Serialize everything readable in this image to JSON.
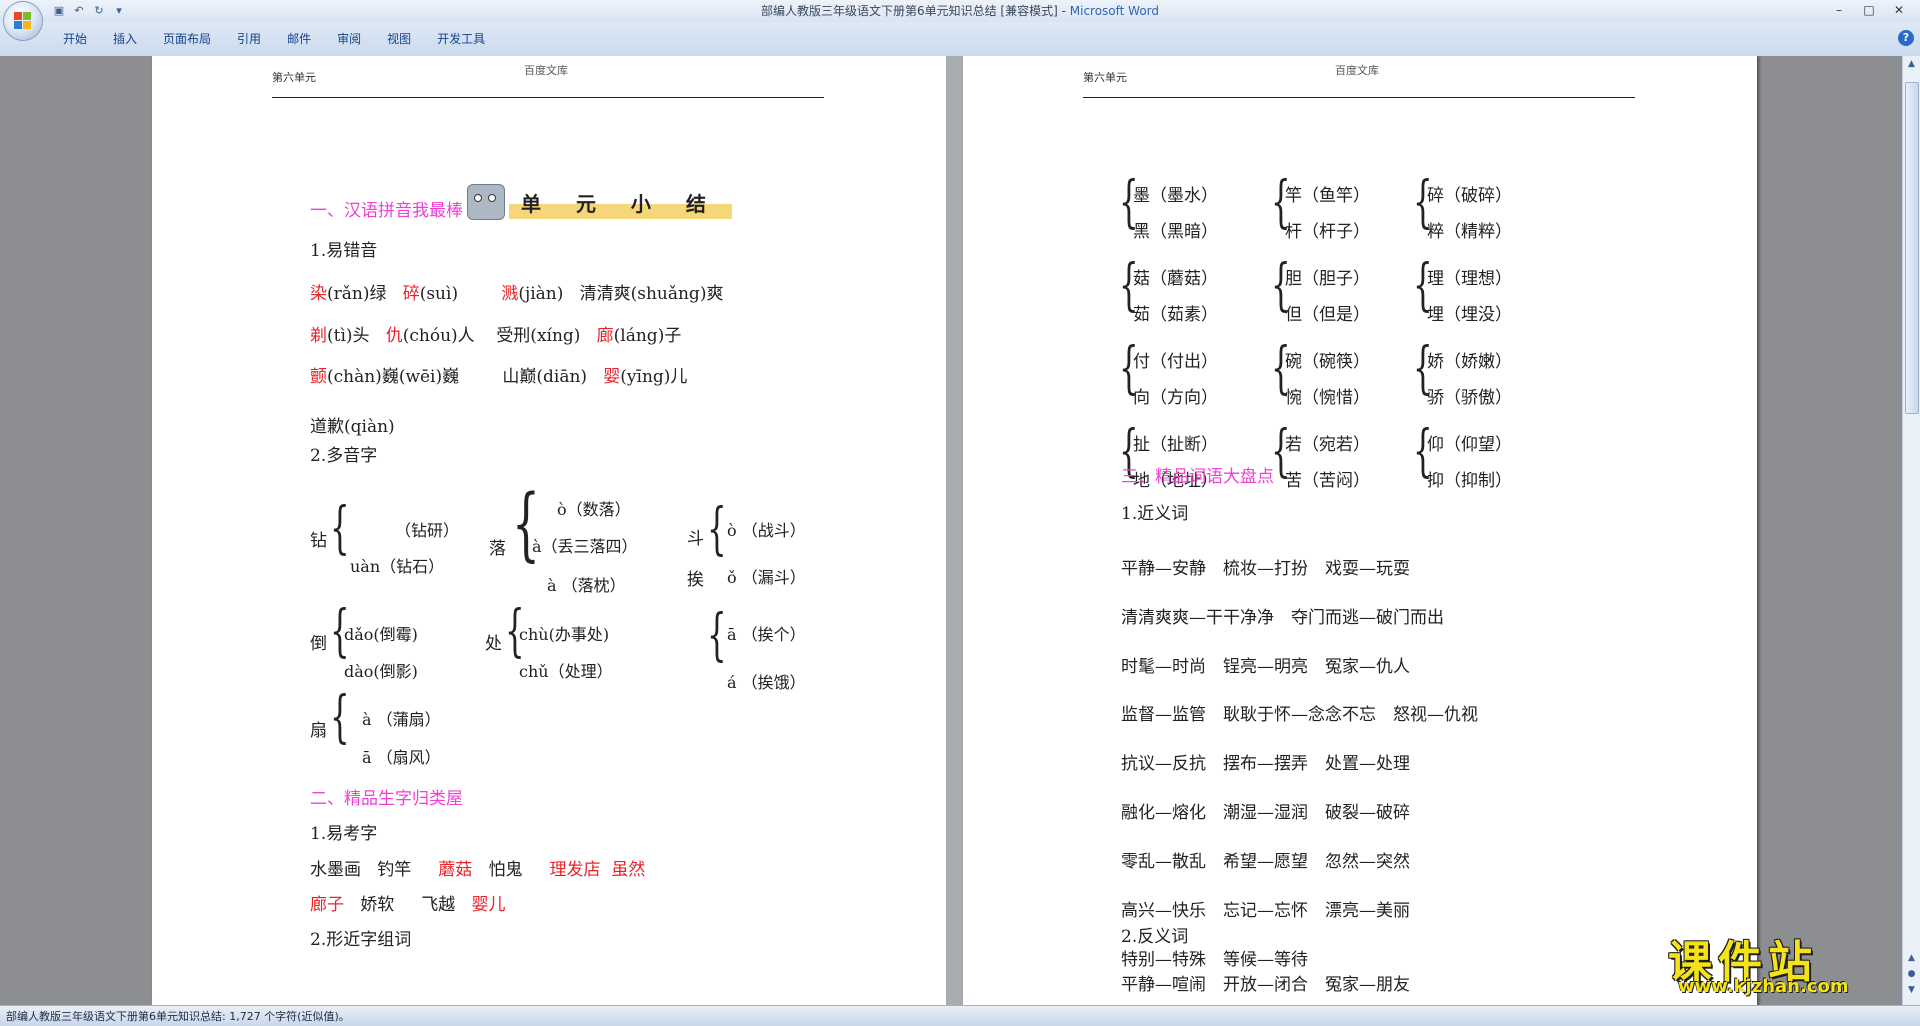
{
  "window": {
    "title": "部编人教版三年级语文下册第6单元知识总结 [兼容模式] - ",
    "app_name": "Microsoft Word",
    "controls": [
      "–",
      "□",
      "✕"
    ]
  },
  "quick_access": {
    "icons": [
      "save-icon",
      "undo-icon",
      "redo-icon",
      "customize-icon"
    ]
  },
  "ribbon": {
    "tabs": [
      "开始",
      "插入",
      "页面布局",
      "引用",
      "邮件",
      "审阅",
      "视图",
      "开发工具"
    ]
  },
  "status": {
    "text": "部编人教版三年级语文下册第6单元知识总结: 1,727 个字符(近似值)。"
  },
  "colors": {
    "red": "#e8232a",
    "pink": "#f23fd4",
    "ribbon": "#dfe9f6"
  },
  "page_left": {
    "header_left": "第六单元",
    "header_center": "百度文库",
    "unit_title": "单 元 小 结",
    "sec1": "一、汉语拼音我最棒",
    "sub1": "1.易错音",
    "row1": [
      "染",
      "(rǎn)绿",
      "碎",
      "(suì)",
      "溅",
      "(jiàn)",
      "清清爽(shuǎng)爽"
    ],
    "row2": [
      "剃",
      "(tì)头",
      "仇",
      "(chóu)人",
      "受刑(xíng)",
      "廊",
      "(láng)子"
    ],
    "row3": [
      "颤",
      "(chàn)巍(wēi)巍",
      "山巅(diān)",
      "婴",
      "(yīng)儿"
    ],
    "row4": "道歉(qiàn)",
    "sub2": "2.多音字",
    "zuan": {
      "char": "钻",
      "a": "（钻研）",
      "b": "uàn（钻石）"
    },
    "luo": {
      "char": "落",
      "a": "ò（数落）",
      "b": "à（丢三落四）",
      "c": "à （落枕）"
    },
    "dou": {
      "char": "斗",
      "a": "ò （战斗）",
      "b": "ǒ （漏斗）"
    },
    "ai": {
      "char": "挨",
      "a": "ā （挨个）",
      "b": "á （挨饿）"
    },
    "dao": {
      "char": "倒",
      "a": "dǎo(倒霉)",
      "b": "dào(倒影)"
    },
    "chu": {
      "char": "处",
      "a": "chù(办事处)",
      "b": "chǔ（处理）"
    },
    "shan": {
      "char": "扇",
      "a": "à （蒲扇）",
      "b": "ā （扇风）"
    },
    "sec2": "二、精品生字归类屋",
    "sub3": "1.易考字",
    "words1": [
      "水墨画",
      "钓竿",
      "蘑菇",
      "怕鬼",
      "理发店",
      "虽然"
    ],
    "words2": [
      "廊子",
      "娇软",
      "飞越",
      "婴儿"
    ],
    "sub4": "2.形近字组词"
  },
  "page_right": {
    "header_left": "第六单元",
    "header_center": "百度文库",
    "groups": [
      [
        [
          "墨（墨水）",
          "黑（黑暗）"
        ],
        [
          "竿（鱼竿）",
          "杆（杆子）"
        ],
        [
          "碎（破碎）",
          "粹（精粹）"
        ]
      ],
      [
        [
          "菇（蘑菇）",
          "茹（茹素）"
        ],
        [
          "胆（胆子）",
          "但（但是）"
        ],
        [
          "理（理想）",
          "埋（埋没）"
        ]
      ],
      [
        [
          "付（付出）",
          "向（方向）"
        ],
        [
          "碗（碗筷）",
          "惋（惋惜）"
        ],
        [
          "娇（娇嫩）",
          "骄（骄傲）"
        ]
      ],
      [
        [
          "扯（扯断）",
          "地（地址）"
        ],
        [
          "若（宛若）",
          "苦（苦闷）"
        ],
        [
          "仰（仰望）",
          "抑（抑制）"
        ]
      ]
    ],
    "sec3": "三、精品词语大盘点",
    "sub1": "1.近义词",
    "syn": [
      "平静—安静　梳妆—打扮　戏耍—玩耍",
      "清清爽爽—干干净净　夺门而逃—破门而出",
      "时髦—时尚　锃亮—明亮　冤家—仇人",
      "监督—监管　耿耿于怀—念念不忘　怒视—仇视",
      "抗议—反抗　摆布—摆弄　处置—处理",
      "融化—熔化　潮湿—湿润　破裂—破碎",
      "零乱—散乱　希望—愿望　忽然—突然",
      "高兴—快乐　忘记—忘怀　漂亮—美丽"
    ],
    "sub2": "2.反义词",
    "ant": [
      "特别—特殊　等候—等待",
      "平静—喧闹　开放—闭合　冤家—朋友"
    ]
  },
  "watermark": {
    "main": "课件站",
    "url": "www.kjzhan.com"
  }
}
